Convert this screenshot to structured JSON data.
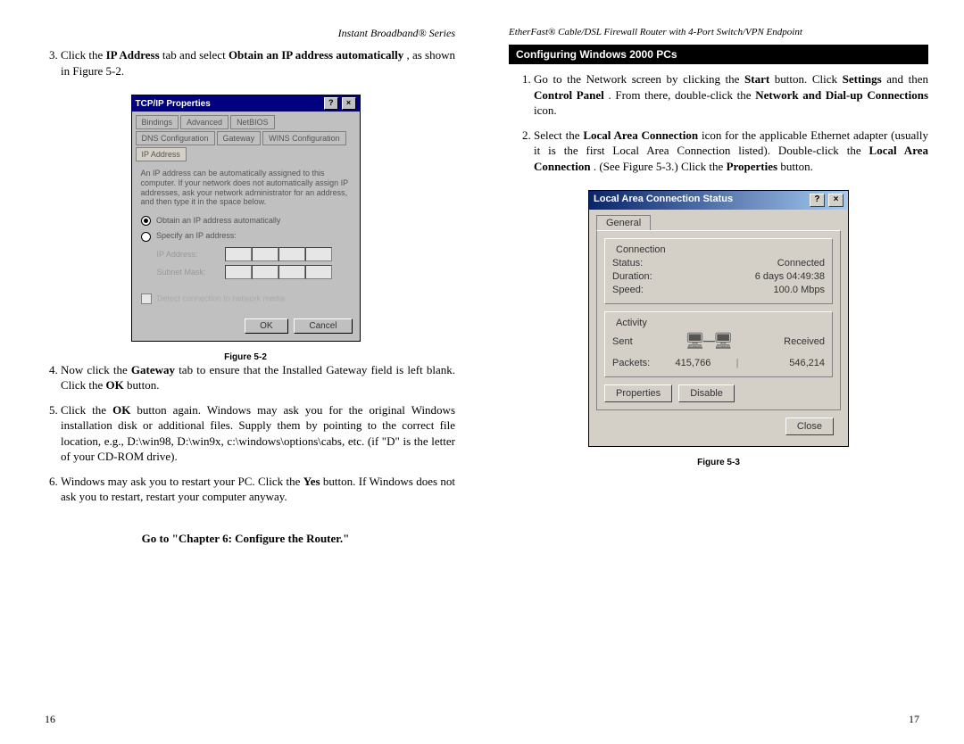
{
  "headers": {
    "left": "Instant Broadband® Series",
    "right": "EtherFast® Cable/DSL Firewall Router with 4-Port Switch/VPN Endpoint"
  },
  "left_column": {
    "step3_pre": "Click the ",
    "step3_b1": "IP Address",
    "step3_mid": " tab and select ",
    "step3_b2": "Obtain an IP address automatically",
    "step3_end": ", as shown in Figure 5-2.",
    "step4_pre": "Now click the ",
    "step4_b1": "Gateway",
    "step4_mid": " tab to ensure that the Installed Gateway field is left blank. Click the ",
    "step4_b2": "OK",
    "step4_end": " button.",
    "step5_pre": "Click the ",
    "step5_b1": "OK",
    "step5_end": " button again.  Windows may ask you for the original Windows installation disk or additional files. Supply them by pointing to the correct file location, e.g., D:\\win98, D:\\win9x, c:\\windows\\options\\cabs, etc. (if \"D\" is the letter of your CD-ROM drive).",
    "step6_pre": "Windows may ask you to restart your PC. Click the ",
    "step6_b1": "Yes",
    "step6_end": " button. If Windows does not ask you to restart, restart your computer anyway.",
    "go_to": "Go to \"Chapter 6: Configure the Router.\""
  },
  "fig52": {
    "label": "Figure 5-2",
    "title": "TCP/IP Properties",
    "tabs": {
      "bindings": "Bindings",
      "advanced": "Advanced",
      "netbios": "NetBIOS",
      "dns": "DNS Configuration",
      "gateway": "Gateway",
      "wins": "WINS Configuration",
      "ip": "IP Address"
    },
    "hint": "An IP address can be automatically assigned to this computer. If your network does not automatically assign IP addresses, ask your network administrator for an address, and then type it in the space below.",
    "radio1": "Obtain an IP address automatically",
    "radio2": "Specify an IP address:",
    "ip_label": "IP Address:",
    "mask_label": "Subnet Mask:",
    "detect": "Detect connection to network media",
    "ok": "OK",
    "cancel": "Cancel"
  },
  "right_column": {
    "section_title": "Configuring Windows 2000 PCs",
    "s1_a": "Go to the Network screen by clicking the ",
    "s1_b1": "Start",
    "s1_b": " button. Click ",
    "s1_b2": "Settings",
    "s1_c": " and then ",
    "s1_b3": "Control Panel",
    "s1_d": ".  From there, double-click the ",
    "s1_b4": "Network and Dial-up Connections",
    "s1_e": " icon.",
    "s2_a": "Select the ",
    "s2_b1": "Local Area Connection",
    "s2_b": " icon for the applicable Ethernet adapter (usually it is the first Local Area Connection listed). Double-click the ",
    "s2_b2": "Local Area Connection",
    "s2_c": ". (See Figure 5-3.) Click the ",
    "s2_b3": "Properties",
    "s2_d": " button."
  },
  "fig53": {
    "label": "Figure 5-3",
    "title": "Local Area Connection Status",
    "tab": "General",
    "grp_conn": "Connection",
    "status_k": "Status:",
    "status_v": "Connected",
    "duration_k": "Duration:",
    "duration_v": "6 days 04:49:38",
    "speed_k": "Speed:",
    "speed_v": "100.0 Mbps",
    "grp_act": "Activity",
    "sent": "Sent",
    "recv": "Received",
    "packets_k": "Packets:",
    "packets_sent": "415,766",
    "packets_recv": "546,214",
    "btn_props": "Properties",
    "btn_disable": "Disable",
    "btn_close": "Close"
  },
  "page_numbers": {
    "left": "16",
    "right": "17"
  }
}
